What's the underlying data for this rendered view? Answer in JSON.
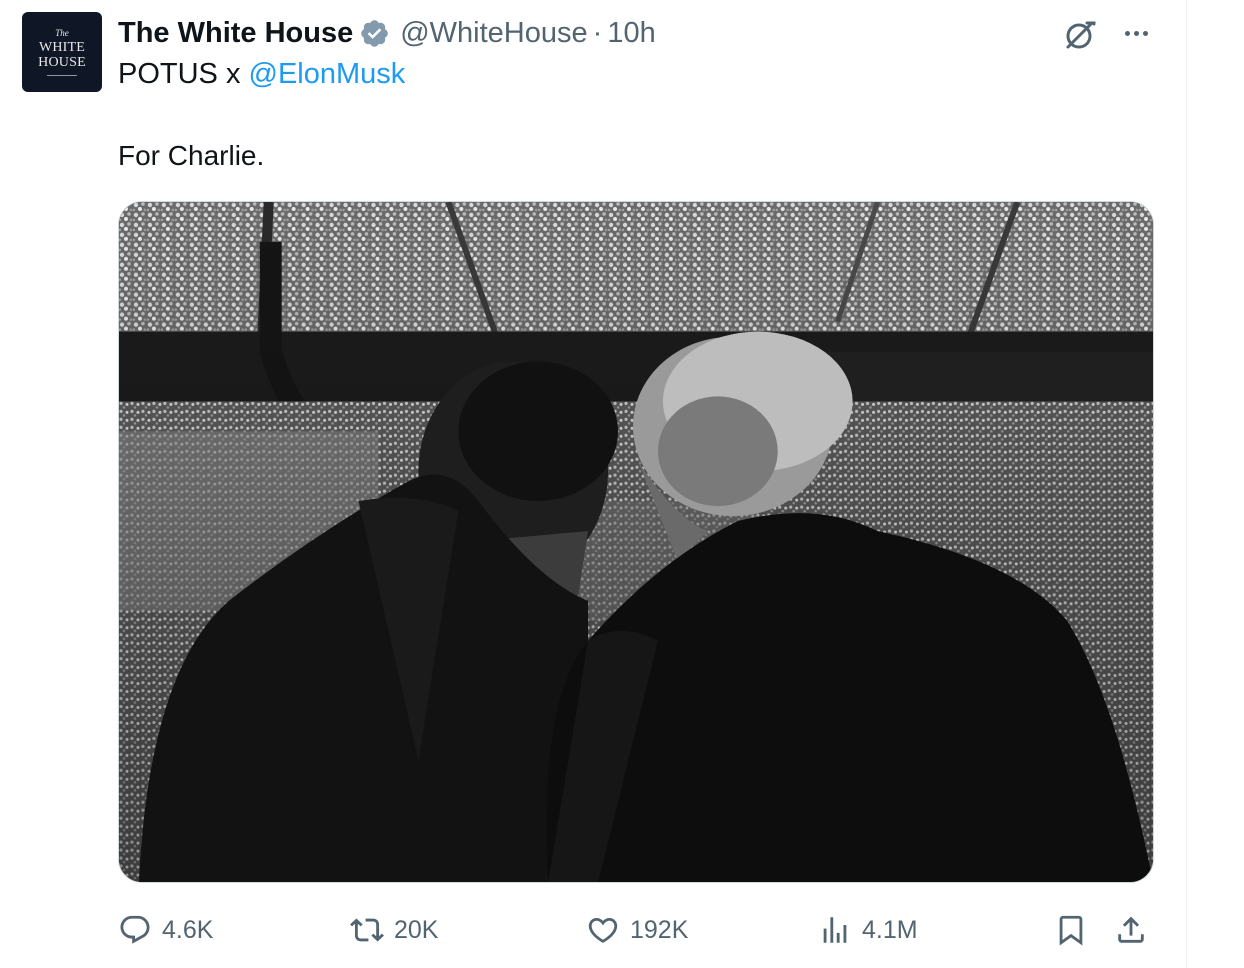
{
  "tweet": {
    "avatar": {
      "line1": "The",
      "line2": "WHITE",
      "line3": "HOUSE"
    },
    "display_name": "The White House",
    "handle": "@WhiteHouse",
    "separator": "·",
    "timestamp": "10h",
    "subline_prefix": "POTUS x ",
    "subline_mention": "@ElonMusk",
    "text": "For Charlie.",
    "verified_color": "#829aab",
    "mention_color": "#1d9bf0"
  },
  "icons": {
    "verified": "verified-badge-icon",
    "grok": "grok-icon",
    "more": "more-icon",
    "reply": "reply-icon",
    "retweet": "retweet-icon",
    "like": "heart-icon",
    "views": "views-icon",
    "bookmark": "bookmark-icon",
    "share": "share-icon"
  },
  "actions": {
    "replies": "4.6K",
    "retweets": "20K",
    "likes": "192K",
    "views": "4.1M"
  }
}
